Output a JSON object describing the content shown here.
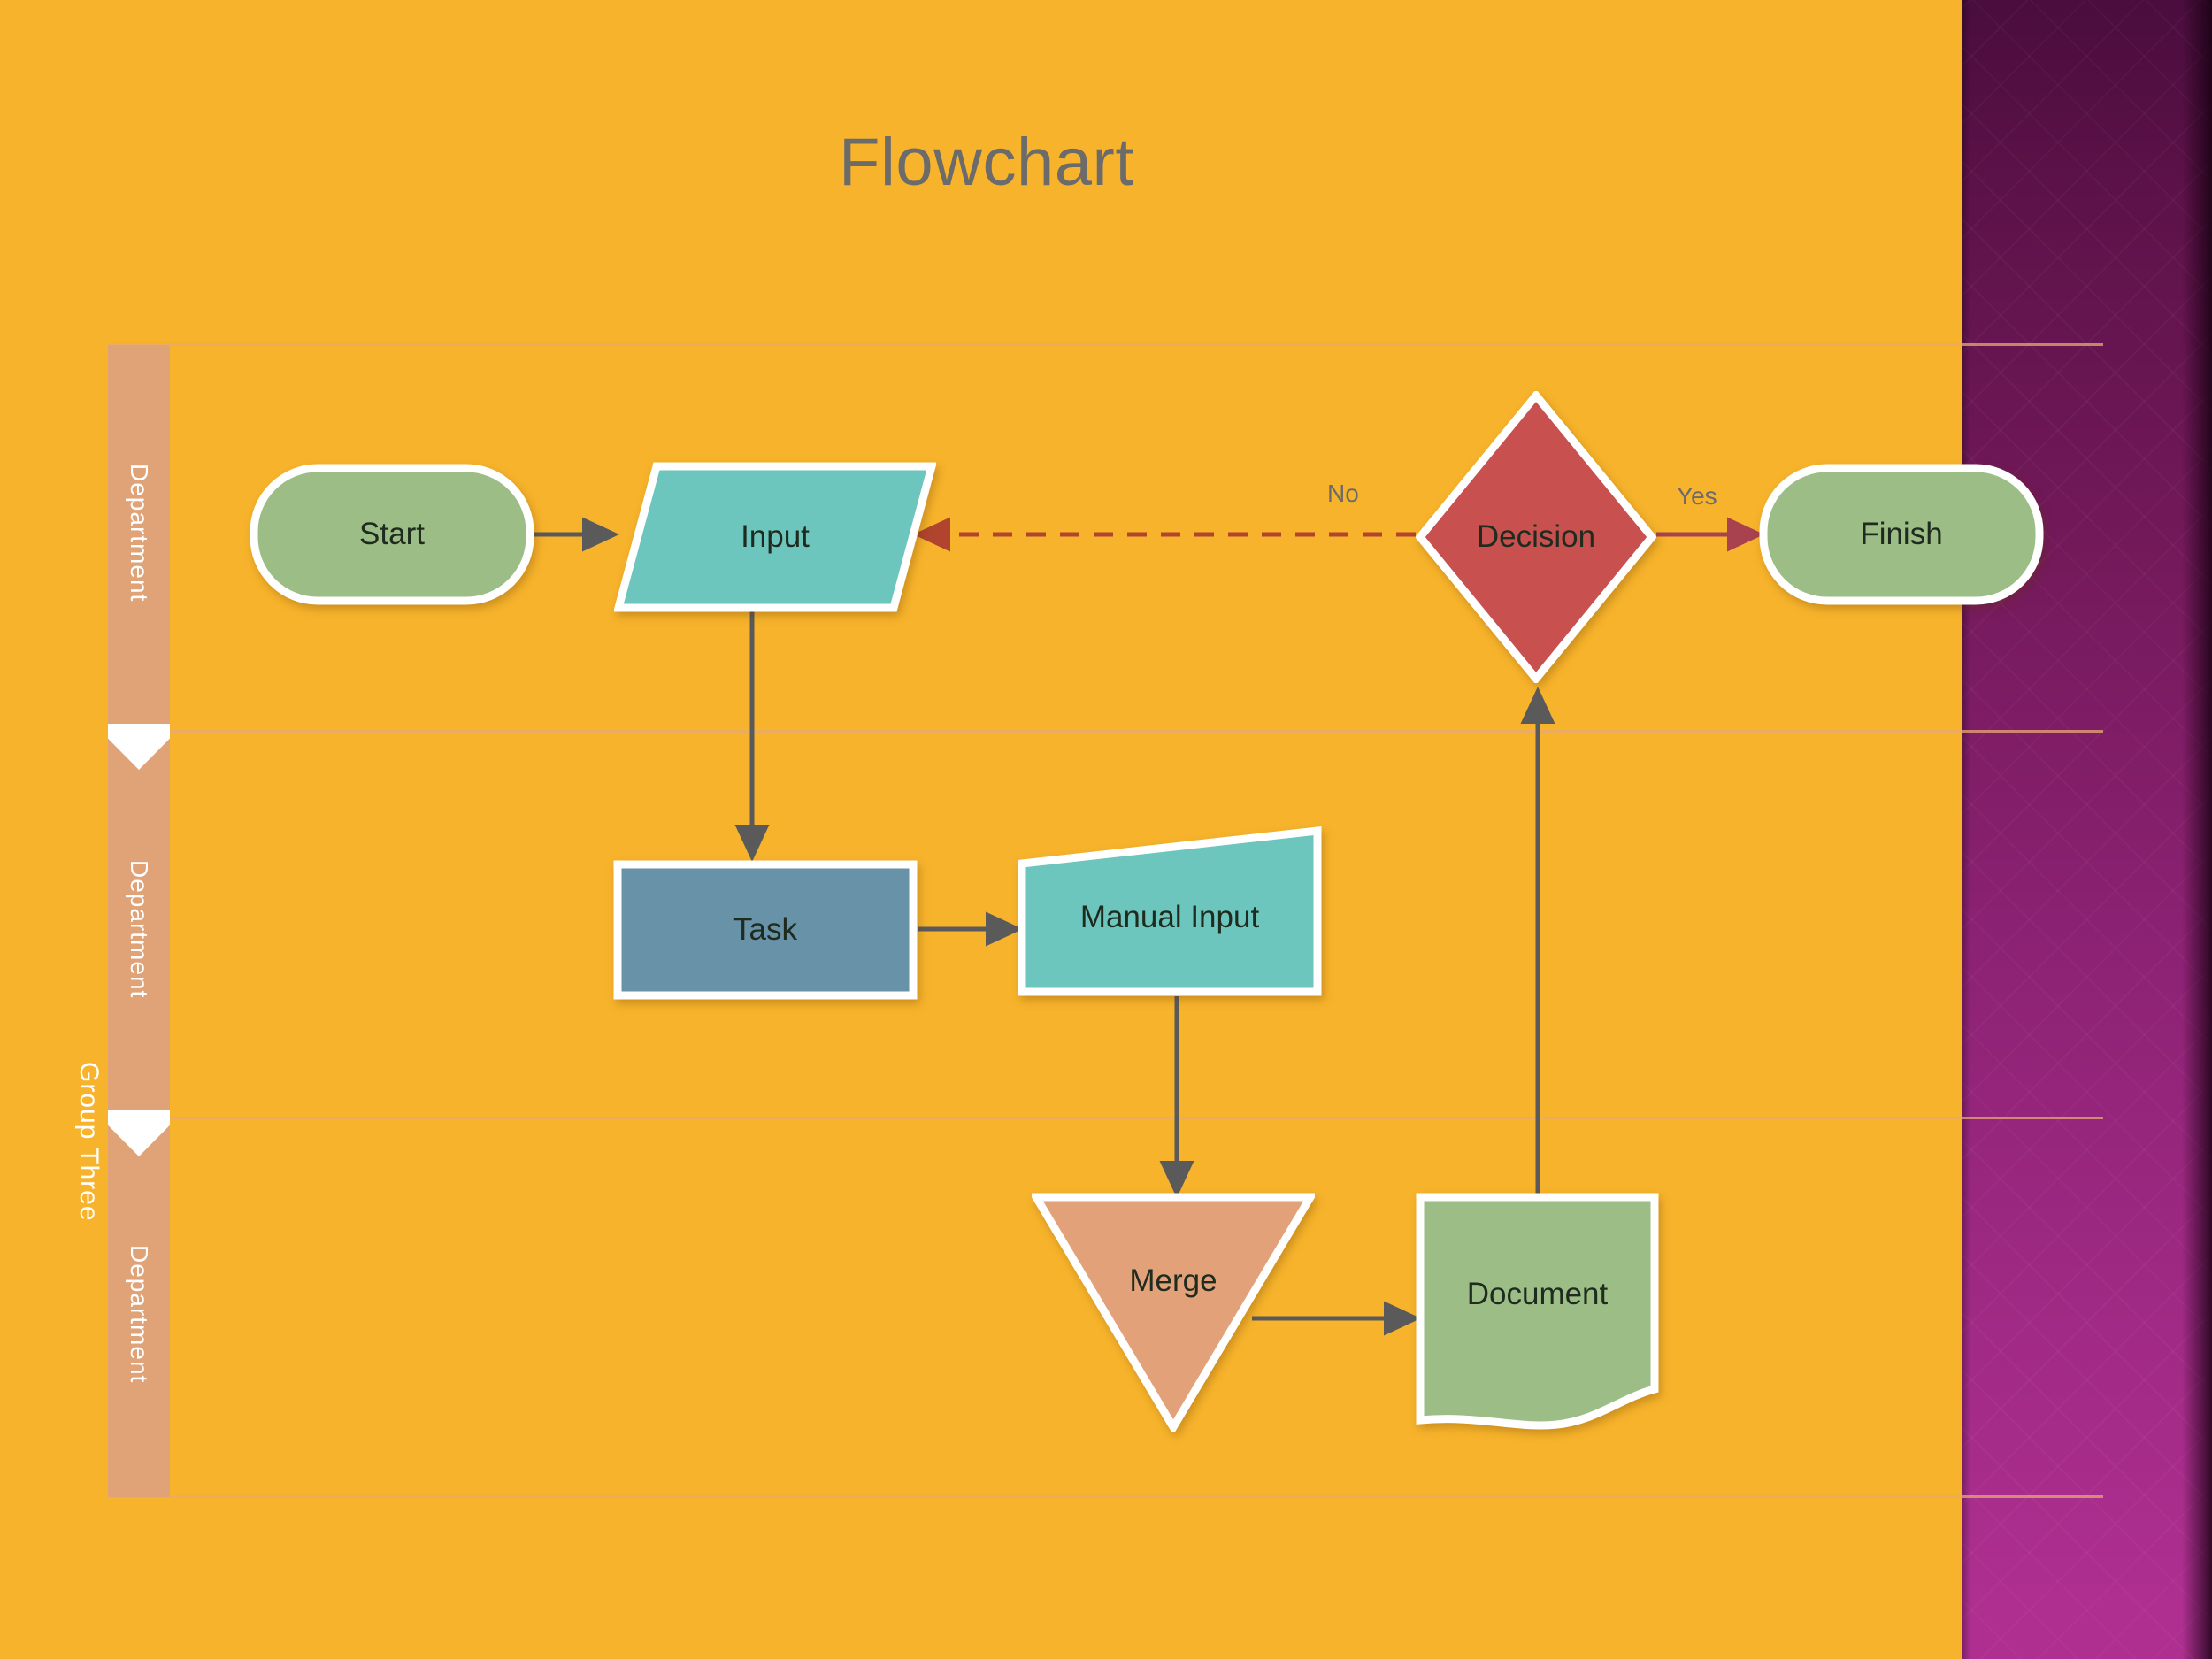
{
  "slide": {
    "title": "Flowchart",
    "background_color": "#F7B32B",
    "accent_panel_color": "#8d2274",
    "title_color": "#6B6B6B"
  },
  "swimlanes": {
    "group_label": "Group Three",
    "lanes": [
      {
        "label": "Department"
      },
      {
        "label": "Department"
      },
      {
        "label": "Department"
      }
    ],
    "lane_band_color": "#E0A378",
    "lane_line_color": "#E8A971"
  },
  "nodes": [
    {
      "id": "start",
      "label": "Start",
      "shape": "terminator",
      "color": "#9CBE86",
      "lane": 1
    },
    {
      "id": "input",
      "label": "Input",
      "shape": "parallelogram",
      "color": "#6DC6BE",
      "lane": 1
    },
    {
      "id": "decision",
      "label": "Decision",
      "shape": "diamond",
      "color": "#C8504F",
      "lane": 1
    },
    {
      "id": "finish",
      "label": "Finish",
      "shape": "terminator",
      "color": "#9CBE86",
      "lane": 1
    },
    {
      "id": "task",
      "label": "Task",
      "shape": "rectangle",
      "color": "#6892A8",
      "lane": 2
    },
    {
      "id": "manual_input",
      "label": "Manual Input",
      "shape": "trapezoid",
      "color": "#6DC6BE",
      "lane": 2
    },
    {
      "id": "merge",
      "label": "Merge",
      "shape": "triangle-down",
      "color": "#E2A179",
      "lane": 3
    },
    {
      "id": "document",
      "label": "Document",
      "shape": "document",
      "color": "#9CBE86",
      "lane": 3
    }
  ],
  "edges": [
    {
      "from": "start",
      "to": "input",
      "label": "",
      "style": "solid",
      "color": "#5A5A5A"
    },
    {
      "from": "input",
      "to": "task",
      "label": "",
      "style": "solid",
      "color": "#5A5A5A"
    },
    {
      "from": "task",
      "to": "manual_input",
      "label": "",
      "style": "solid",
      "color": "#5A5A5A"
    },
    {
      "from": "manual_input",
      "to": "merge",
      "label": "",
      "style": "solid",
      "color": "#5A5A5A"
    },
    {
      "from": "merge",
      "to": "document",
      "label": "",
      "style": "solid",
      "color": "#5A5A5A"
    },
    {
      "from": "document",
      "to": "decision",
      "label": "",
      "style": "solid",
      "color": "#5A5A5A"
    },
    {
      "from": "decision",
      "to": "finish",
      "label": "Yes",
      "style": "solid",
      "color": "#A8424F"
    },
    {
      "from": "decision",
      "to": "input",
      "label": "No",
      "style": "dashed",
      "color": "#B0442E"
    }
  ],
  "edge_labels": {
    "yes": "Yes",
    "no": "No"
  }
}
